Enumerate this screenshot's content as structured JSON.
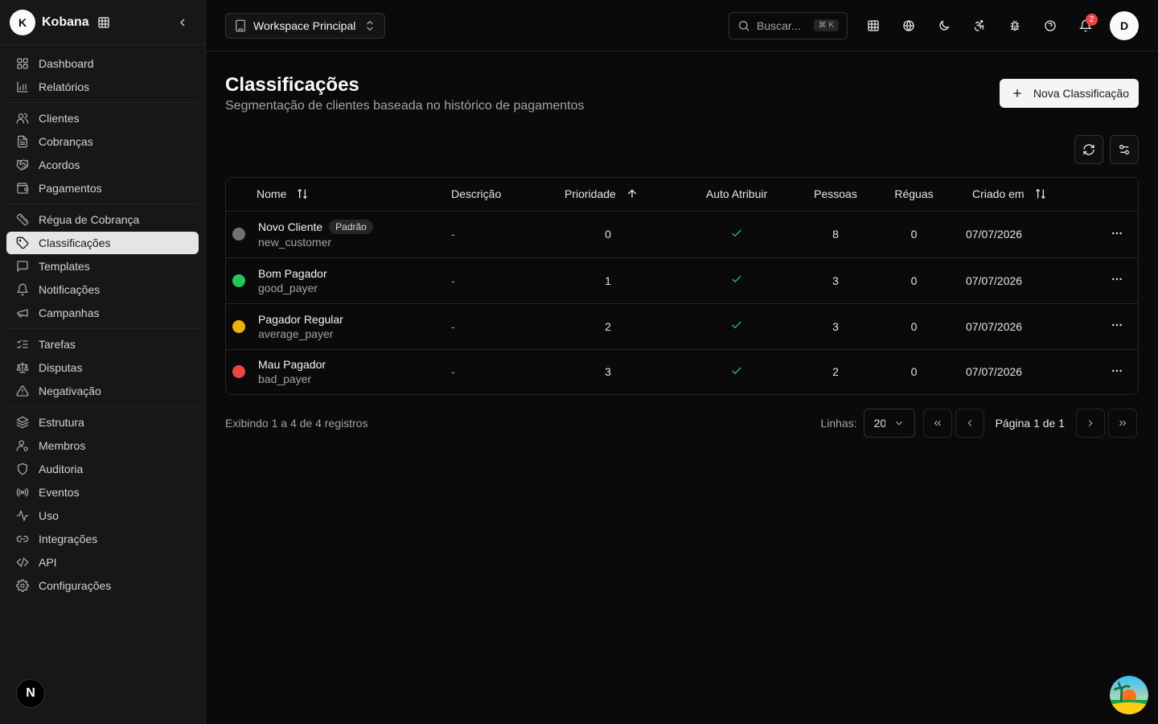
{
  "brand": {
    "initial": "K",
    "name": "Kobana"
  },
  "sidebar": {
    "groups": [
      [
        {
          "label": "Dashboard",
          "icon": "layout-grid-icon"
        },
        {
          "label": "Relatórios",
          "icon": "bar-chart-icon"
        }
      ],
      [
        {
          "label": "Clientes",
          "icon": "users-icon"
        },
        {
          "label": "Cobranças",
          "icon": "file-text-icon"
        },
        {
          "label": "Acordos",
          "icon": "handshake-icon"
        },
        {
          "label": "Pagamentos",
          "icon": "wallet-icon"
        }
      ],
      [
        {
          "label": "Régua de Cobrança",
          "icon": "ruler-icon"
        },
        {
          "label": "Classificações",
          "icon": "tag-icon",
          "active": true
        },
        {
          "label": "Templates",
          "icon": "message-square-icon"
        },
        {
          "label": "Notificações",
          "icon": "bell-icon"
        },
        {
          "label": "Campanhas",
          "icon": "megaphone-icon"
        }
      ],
      [
        {
          "label": "Tarefas",
          "icon": "list-checks-icon"
        },
        {
          "label": "Disputas",
          "icon": "scale-icon"
        },
        {
          "label": "Negativação",
          "icon": "alert-triangle-icon"
        }
      ],
      [
        {
          "label": "Estrutura",
          "icon": "layers-icon"
        },
        {
          "label": "Membros",
          "icon": "user-cog-icon"
        },
        {
          "label": "Auditoria",
          "icon": "shield-icon"
        },
        {
          "label": "Eventos",
          "icon": "radio-icon"
        },
        {
          "label": "Uso",
          "icon": "activity-icon"
        },
        {
          "label": "Integrações",
          "icon": "link-icon"
        },
        {
          "label": "API",
          "icon": "code-icon"
        },
        {
          "label": "Configurações",
          "icon": "settings-icon"
        }
      ]
    ],
    "footer_initial": "N"
  },
  "topbar": {
    "workspace": "Workspace Principal",
    "search_label": "Buscar...",
    "search_shortcut": "⌘ K",
    "notifications_count": "2",
    "user_initial": "D"
  },
  "page": {
    "title": "Classificações",
    "subtitle": "Segmentação de clientes baseada no histórico de pagamentos",
    "new_button": "Nova Classificação"
  },
  "table": {
    "headers": {
      "name": "Nome",
      "description": "Descrição",
      "priority": "Prioridade",
      "auto_assign": "Auto Atribuir",
      "people": "Pessoas",
      "rulers": "Réguas",
      "created": "Criado em"
    },
    "rows": [
      {
        "name": "Novo Cliente",
        "code": "new_customer",
        "badge": "Padrão",
        "color": "#71717a",
        "description": "-",
        "priority": "0",
        "auto": true,
        "people": "8",
        "rulers": "0",
        "created": "07/07/2026"
      },
      {
        "name": "Bom Pagador",
        "code": "good_payer",
        "badge": "",
        "color": "#22c55e",
        "description": "-",
        "priority": "1",
        "auto": true,
        "people": "3",
        "rulers": "0",
        "created": "07/07/2026"
      },
      {
        "name": "Pagador Regular",
        "code": "average_payer",
        "badge": "",
        "color": "#eab308",
        "description": "-",
        "priority": "2",
        "auto": true,
        "people": "3",
        "rulers": "0",
        "created": "07/07/2026"
      },
      {
        "name": "Mau Pagador",
        "code": "bad_payer",
        "badge": "",
        "color": "#ef4444",
        "description": "-",
        "priority": "3",
        "auto": true,
        "people": "2",
        "rulers": "0",
        "created": "07/07/2026"
      }
    ]
  },
  "pagination": {
    "records": "Exibindo 1 a 4 de 4 registros",
    "rows_label": "Linhas:",
    "rows_value": "20",
    "page_text": "Página 1 de 1"
  }
}
